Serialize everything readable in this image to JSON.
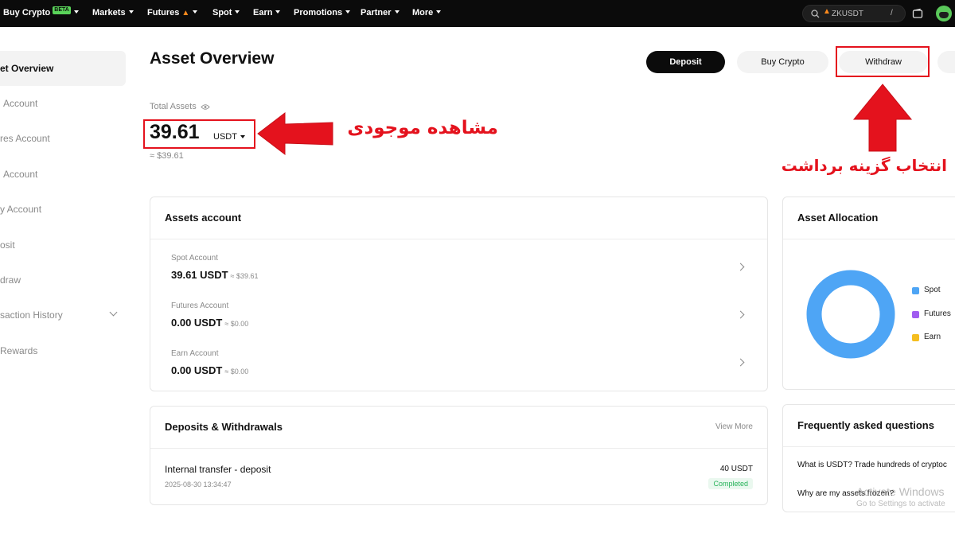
{
  "nav": {
    "items": [
      "Buy Crypto",
      "Markets",
      "Futures",
      "Spot",
      "Earn",
      "Promotions",
      "Partner",
      "More"
    ],
    "beta_badge": "BETA",
    "search_value": "ZKUSDT",
    "search_shortcut": "/"
  },
  "sidebar": {
    "items": [
      "et Overview",
      "Account",
      "res Account",
      "Account",
      "y Account",
      "osit",
      "draw",
      "saction History",
      "Rewards"
    ]
  },
  "header": {
    "title": "Asset Overview",
    "deposit_label": "Deposit",
    "buy_label": "Buy Crypto",
    "withdraw_label": "Withdraw"
  },
  "total": {
    "label": "Total Assets",
    "value": "39.61",
    "currency": "USDT",
    "approx": "≈ $39.61"
  },
  "assets_account": {
    "title": "Assets account",
    "rows": [
      {
        "label": "Spot Account",
        "value": "39.61 USDT",
        "approx": "≈ $39.61"
      },
      {
        "label": "Futures Account",
        "value": "0.00 USDT",
        "approx": "≈ $0.00"
      },
      {
        "label": "Earn Account",
        "value": "0.00 USDT",
        "approx": "≈ $0.00"
      }
    ]
  },
  "allocation": {
    "title": "Asset Allocation",
    "legend": [
      {
        "name": "Spot",
        "color": "#4ea5f5"
      },
      {
        "name": "Futures",
        "color": "#a05cf0"
      },
      {
        "name": "Earn",
        "color": "#f5be1f"
      }
    ],
    "spot_share": 1.0
  },
  "deposits": {
    "title": "Deposits & Withdrawals",
    "view_more": "View More",
    "item_title": "Internal transfer - deposit",
    "item_date": "2025-08-30 13:34:47",
    "item_amount": "40 USDT",
    "item_status": "Completed"
  },
  "faq": {
    "title": "Frequently asked questions",
    "q1": "What is USDT? Trade hundreds of cryptoc",
    "q2": "Why are my assets frozen?"
  },
  "annotations": {
    "balance_note": "مشاهده موجودی",
    "withdraw_note": "انتخاب گزینه برداشت"
  },
  "watermark": {
    "line1": "Activate Windows",
    "line2": "Go to Settings to activate"
  },
  "colors": {
    "annotation_red": "#e4121d",
    "status_green": "#27b35a",
    "spot_blue": "#4ea5f5"
  }
}
